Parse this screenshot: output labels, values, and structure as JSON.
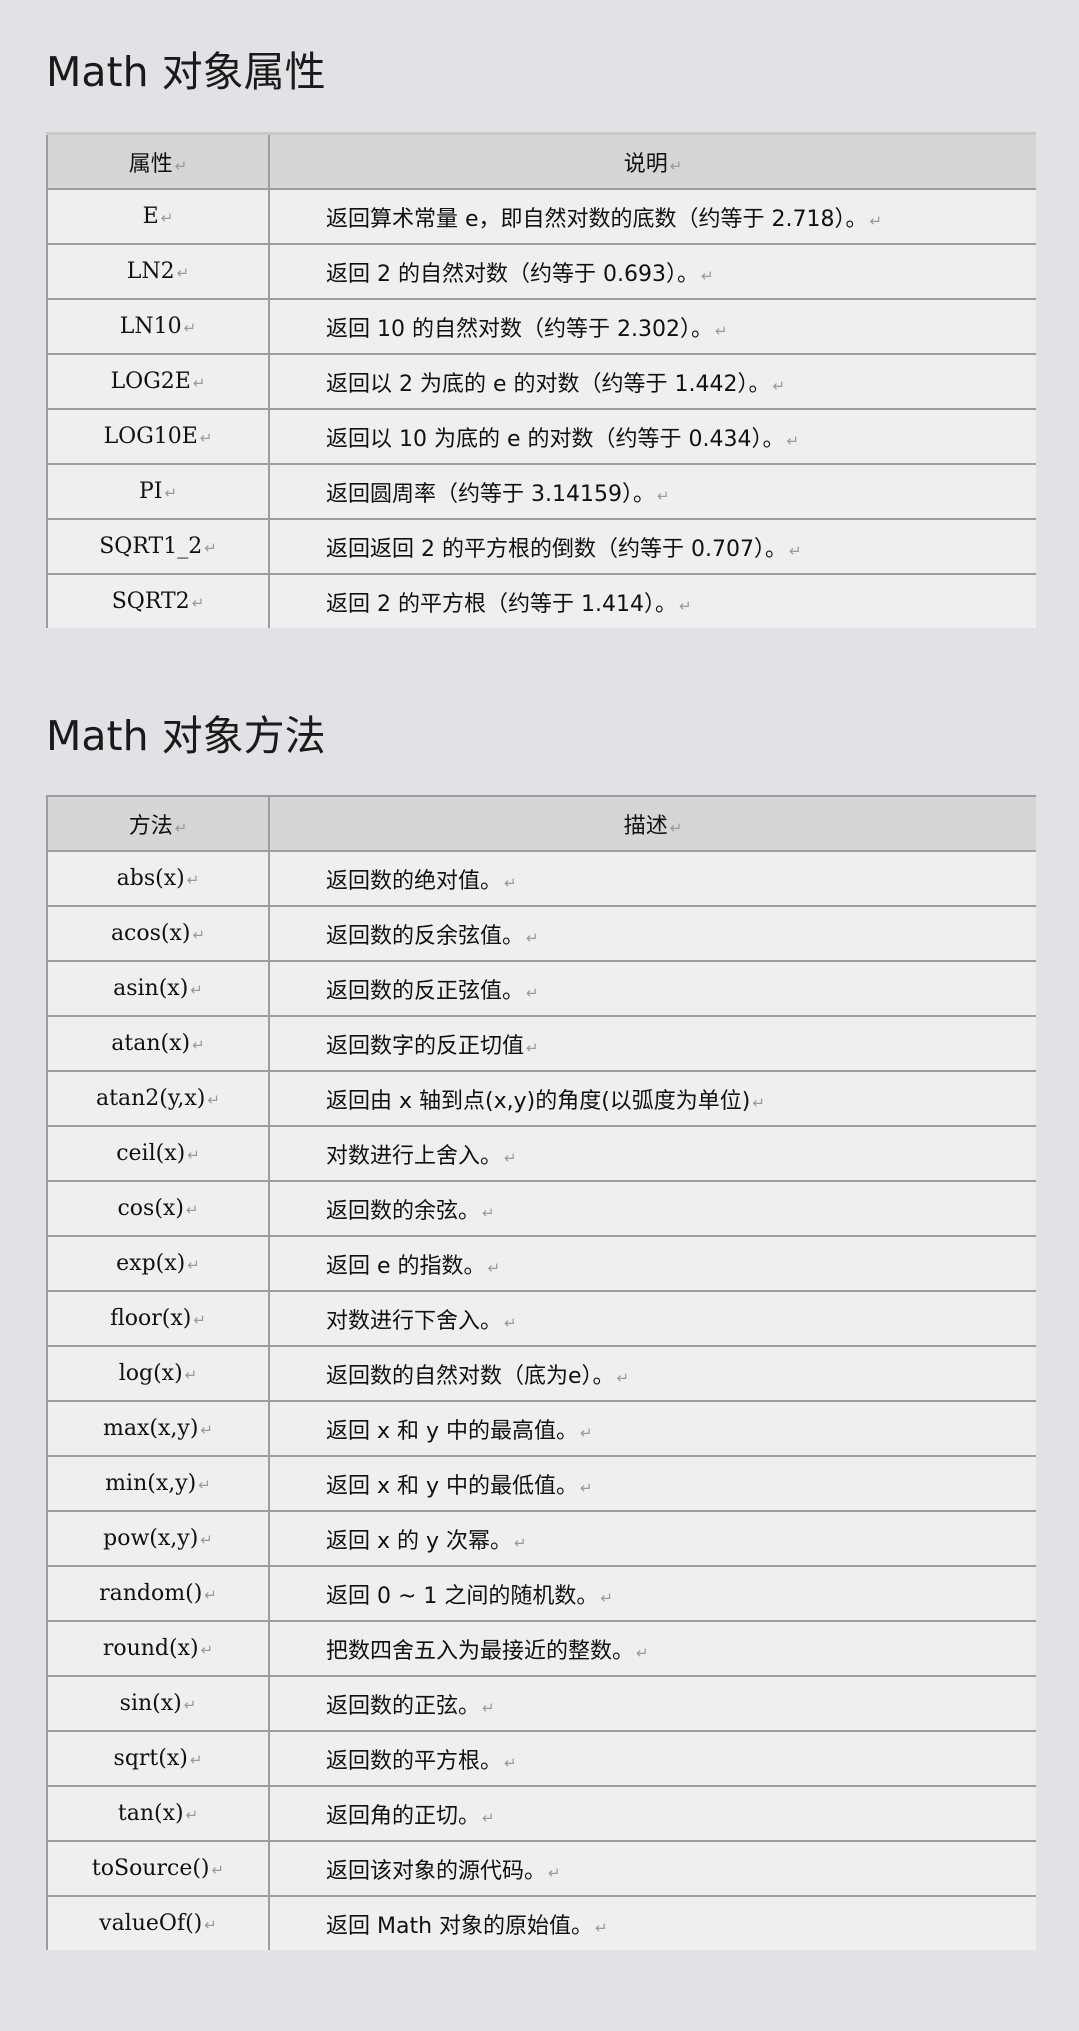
{
  "sections": {
    "properties_title": "Math 对象属性",
    "methods_title": "Math 对象方法"
  },
  "properties": {
    "header": {
      "col1": "属性",
      "col2": "说明"
    },
    "rows": [
      {
        "name": "E",
        "desc": "返回算术常量 e，即自然对数的底数（约等于 2.718）。"
      },
      {
        "name": "LN2",
        "desc": "返回 2 的自然对数（约等于 0.693）。"
      },
      {
        "name": "LN10",
        "desc": "返回 10 的自然对数（约等于 2.302）。"
      },
      {
        "name": "LOG2E",
        "desc": "返回以 2 为底的 e 的对数（约等于 1.442）。"
      },
      {
        "name": "LOG10E",
        "desc": "返回以 10 为底的 e 的对数（约等于 0.434）。"
      },
      {
        "name": "PI",
        "desc": "返回圆周率（约等于 3.14159）。"
      },
      {
        "name": "SQRT1_2",
        "desc": "返回返回 2 的平方根的倒数（约等于 0.707）。"
      },
      {
        "name": "SQRT2",
        "desc": "返回 2 的平方根（约等于 1.414）。"
      }
    ]
  },
  "methods": {
    "header": {
      "col1": "方法",
      "col2": "描述"
    },
    "rows": [
      {
        "name": "abs(x)",
        "desc": "返回数的绝对值。"
      },
      {
        "name": "acos(x)",
        "desc": "返回数的反余弦值。"
      },
      {
        "name": "asin(x)",
        "desc": "返回数的反正弦值。"
      },
      {
        "name": "atan(x)",
        "desc": "返回数字的反正切值"
      },
      {
        "name": "atan2(y,x)",
        "desc": "返回由 x 轴到点(x,y)的角度(以弧度为单位)"
      },
      {
        "name": "ceil(x)",
        "desc": "对数进行上舍入。"
      },
      {
        "name": "cos(x)",
        "desc": "返回数的余弦。"
      },
      {
        "name": "exp(x)",
        "desc": "返回 e 的指数。"
      },
      {
        "name": "floor(x)",
        "desc": "对数进行下舍入。"
      },
      {
        "name": "log(x)",
        "desc": "返回数的自然对数（底为e）。"
      },
      {
        "name": "max(x,y)",
        "desc": "返回 x 和 y 中的最高值。"
      },
      {
        "name": "min(x,y)",
        "desc": "返回 x 和 y 中的最低值。"
      },
      {
        "name": "pow(x,y)",
        "desc": "返回 x 的 y 次幂。"
      },
      {
        "name": "random()",
        "desc": "返回 0 ~ 1 之间的随机数。"
      },
      {
        "name": "round(x)",
        "desc": "把数四舍五入为最接近的整数。"
      },
      {
        "name": "sin(x)",
        "desc": "返回数的正弦。"
      },
      {
        "name": "sqrt(x)",
        "desc": "返回数的平方根。"
      },
      {
        "name": "tan(x)",
        "desc": "返回角的正切。"
      },
      {
        "name": "toSource()",
        "desc": "返回该对象的源代码。"
      },
      {
        "name": "valueOf()",
        "desc": "返回 Math 对象的原始值。"
      }
    ]
  },
  "paragraph_mark": "↵"
}
